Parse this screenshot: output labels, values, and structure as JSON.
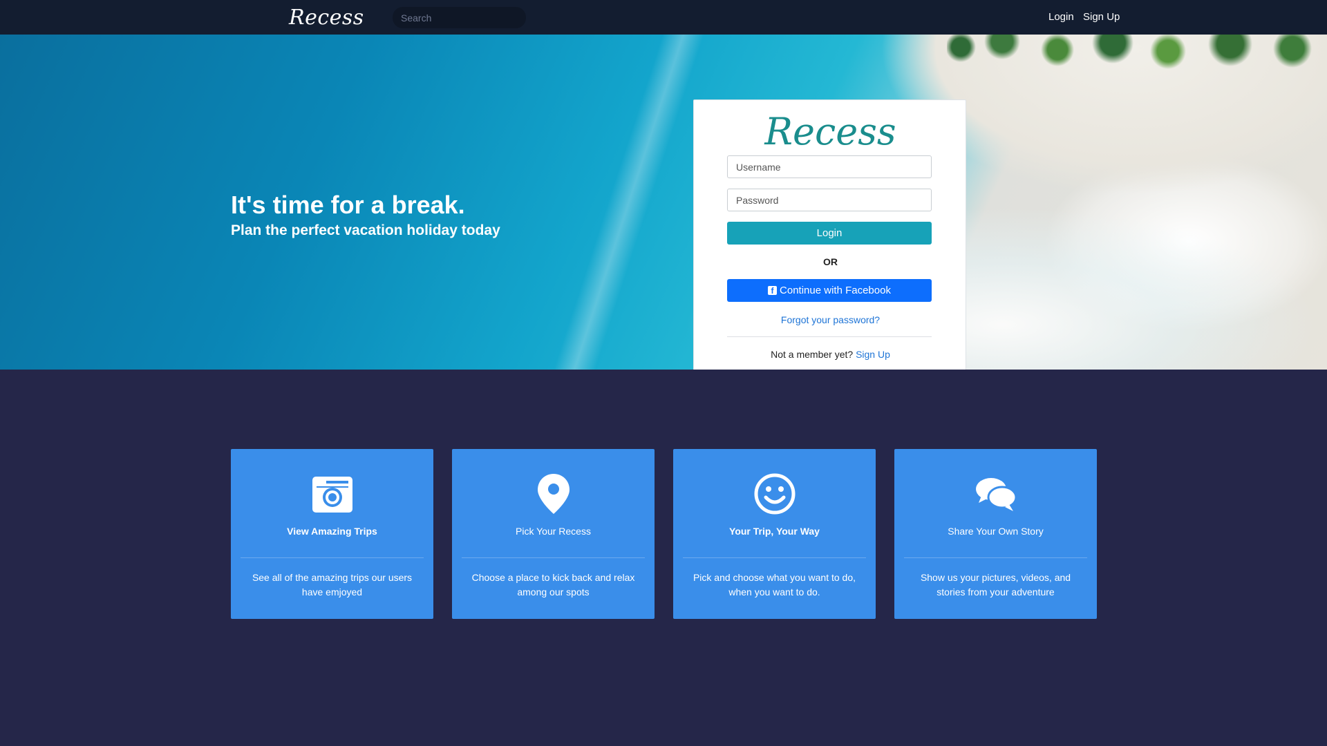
{
  "navbar": {
    "brand": "Recess",
    "search_placeholder": "Search",
    "login": "Login",
    "signup": "Sign Up"
  },
  "hero": {
    "title": "It's time for a break.",
    "subtitle": "Plan the perfect vacation holiday today"
  },
  "login_card": {
    "logo": "Recess",
    "username_placeholder": "Username",
    "password_placeholder": "Password",
    "login_button": "Login",
    "or": "OR",
    "facebook_button": "Continue with Facebook",
    "forgot": "Forgot your password?",
    "member_prompt": "Not a member yet?",
    "signup_link": "Sign Up"
  },
  "features": [
    {
      "icon": "camera-icon",
      "title": "View Amazing Trips",
      "desc": "See all of the amazing trips our users have emjoyed"
    },
    {
      "icon": "map-pin-icon",
      "title": "Pick Your Recess",
      "desc": "Choose a place to kick back and relax among our spots"
    },
    {
      "icon": "smiley-icon",
      "title": "Your Trip, Your Way",
      "desc": "Pick and choose what you want to do, when you want to do."
    },
    {
      "icon": "chat-bubbles-icon",
      "title": "Share Your Own Story",
      "desc": "Show us your pictures, videos, and stories from your adventure"
    }
  ],
  "colors": {
    "navbar": "#131d30",
    "page_bg": "#252649",
    "login_button": "#17a2b8",
    "facebook_button": "#0d6efd",
    "feature_card": "#3a8eea",
    "logo": "#1a8d8d"
  }
}
